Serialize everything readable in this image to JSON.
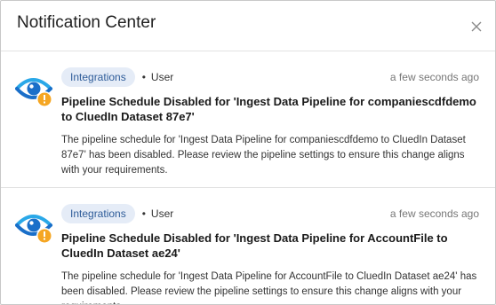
{
  "dialog": {
    "title": "Notification Center"
  },
  "notifications": [
    {
      "category": "Integrations",
      "separator": "•",
      "actor": "User",
      "time": "a few seconds ago",
      "title": "Pipeline Schedule Disabled for 'Ingest Data Pipeline for companiescdfdemo to CluedIn Dataset 87e7'",
      "message": "The pipeline schedule for 'Ingest Data Pipeline for companiescdfdemo to CluedIn Dataset 87e7' has been disabled. Please review the pipeline settings to ensure this change aligns with your requirements."
    },
    {
      "category": "Integrations",
      "separator": "•",
      "actor": "User",
      "time": "a few seconds ago",
      "title": "Pipeline Schedule Disabled for 'Ingest Data Pipeline for AccountFile to CluedIn Dataset ae24'",
      "message": "The pipeline schedule for 'Ingest Data Pipeline for AccountFile to CluedIn Dataset ae24' has been disabled. Please review the pipeline settings to ensure this change aligns with your requirements."
    }
  ],
  "colors": {
    "eye_dark": "#1a6fc9",
    "eye_light": "#2aa8e8",
    "warning": "#f5a623",
    "badge_bg": "#e5ecf7",
    "badge_text": "#2e5c99"
  },
  "icons": {
    "notification": "eye-warning-icon",
    "close": "close-icon"
  }
}
